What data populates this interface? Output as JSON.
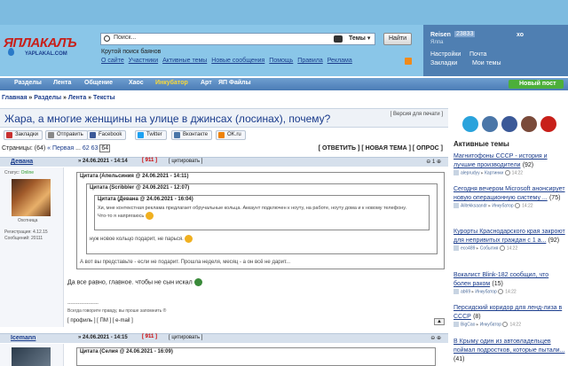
{
  "header": {
    "logo_text": "ЯПЛАКАЛЪ",
    "logo_sub": "YAPLAKAL.COM",
    "search_placeholder": "Поиск...",
    "search_scope": "Темы",
    "find_button": "Найти",
    "search_hint": "Крутой поиск баянов",
    "links": [
      "О сайте",
      "Участники",
      "Активные темы",
      "Новые сообщения",
      "Помощь",
      "Правила",
      "Реклама"
    ],
    "user": {
      "name": "Reisen",
      "id": "23833",
      "xo": "хо",
      "sub": "Ялпа",
      "settings": "Настройки",
      "mail": "Почта",
      "bookmarks": "Закладки",
      "my_themes": "Мои темы"
    }
  },
  "nav": {
    "items": [
      "Разделы",
      "Лента",
      "Общение",
      "Хаос",
      "Инкубатор",
      "Арт",
      "ЯП Файлы"
    ],
    "new_post": "Новый пост"
  },
  "breadcrumb": [
    "Главная",
    "Разделы",
    "Лента",
    "Тексты"
  ],
  "topic": {
    "title": "Жара, а многие женщины на улице в джинсах (лосинах), почему?",
    "print_link": "[ Версия для печати ]"
  },
  "share": [
    "Закладки",
    "Отправить",
    "Facebook",
    "Twitter",
    "Вконтакте",
    "OK.ru"
  ],
  "pages": {
    "left": "Страницы: (64)",
    "first": "« Первая",
    "nums": [
      "62",
      "63"
    ],
    "current": "64",
    "answer": "[ ОТВЕТИТЬ ]",
    "new_topic": "[ НОВАЯ ТЕМА ]",
    "poll": "[ ОПРОС ]"
  },
  "posts": [
    {
      "author": "Девана",
      "date": "24.06.2021 - 14:14",
      "rating": "911",
      "quote_label": "[ цитировать ]",
      "vote": "1",
      "status_label": "Статус:",
      "status": "Online",
      "title": "Охотница",
      "reg_label": "Регистрация:",
      "reg": "4.12.15",
      "msgs_label": "Сообщений:",
      "msgs": "20111",
      "q1_head": "Цитата (Апельсиния @ 24.06.2021 - 14:11)",
      "q2_head": "Цитата (Scribbler @ 24.06.2021 - 12:07)",
      "q3_head": "Цитата (Девана @ 24.06.2021 - 16:04)",
      "q3_text": "Хи, мне контекстная реклама предлагает обручальные кольца. Аккаунт подключен к ноуту, на работе, ноуту дома и к новому телефону. Что-то я напрягаюсь",
      "q2_text": "нуж новое кольцо подарит, не парься.",
      "q1_text": "А вот вы представьте - если не подарит. Прошла неделя, месяц - а он всё не дарит...",
      "text": "Да все равно, главное. чтобы не сын искал",
      "sig_line": "---------------------",
      "sig": "Всегда говорите правду, вы проше запомнить ®",
      "footer": "[ профиль ] [ ПМ ] [ e-mail ]"
    },
    {
      "author": "Icemann",
      "date": "24.06.2021 - 14:15",
      "rating": "911",
      "quote_label": "[ цитировать ]",
      "q1_head": "Цитата (Селия @ 24.06.2021 - 16:09)"
    }
  ],
  "sidebar": {
    "active_title": "Активные темы",
    "items": [
      {
        "title": "Магнитофоны СССР - история и лучшие производители",
        "count": "(92)",
        "author": "aleprudyy",
        "section": "Картинки",
        "time": "14:22"
      },
      {
        "title": "Сегодня вечером Microsoft анонсирует новую операционную систему ...",
        "count": "(75)",
        "author": "Alitekksaandr",
        "section": "Инкубатор",
        "time": "14:22"
      },
      {
        "title": "Курорты Краснодарского края закроют для непривитых граждан с 1 а...",
        "count": "(92)",
        "author": "eco489",
        "section": "События",
        "time": "14:22"
      },
      {
        "title": "Вокалист Blink-182 сообщил, что болен раком",
        "count": "(15)",
        "author": "ab69",
        "section": "Инкубатор",
        "time": "14:22"
      },
      {
        "title": "Персидский коридор для ленд-лиза в СССР",
        "count": "(8)",
        "author": "BigCao",
        "section": "Инкубатор",
        "time": "14:22"
      },
      {
        "title": "В Крыму один из автовладельцев поймал подростков, которые пытали...",
        "count": "(41)",
        "author": "",
        "section": "",
        "time": ""
      }
    ]
  },
  "colors": {
    "header": "#8ac6e8",
    "nav": "#4a7bb5",
    "user_panel": "#4f7fb2",
    "link": "#1a3c8c",
    "rating": "#cc0000"
  }
}
